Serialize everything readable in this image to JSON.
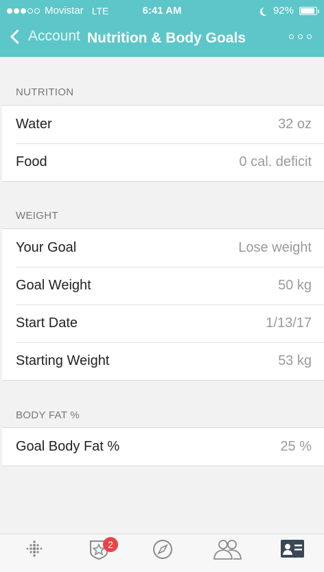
{
  "status": {
    "carrier": "Movistar",
    "network": "LTE",
    "time": "6:41 AM",
    "battery_text": "92%",
    "battery_level": 0.92,
    "signal_bars": 3
  },
  "nav": {
    "back_label": "Account",
    "title": "Nutrition & Body Goals"
  },
  "sections": {
    "nutrition": {
      "header": "NUTRITION",
      "rows": [
        {
          "label": "Water",
          "value": "32 oz"
        },
        {
          "label": "Food",
          "value": "0 cal. deficit"
        }
      ]
    },
    "weight": {
      "header": "WEIGHT",
      "rows": [
        {
          "label": "Your Goal",
          "value": "Lose weight"
        },
        {
          "label": "Goal Weight",
          "value": "50 kg"
        },
        {
          "label": "Start Date",
          "value": "1/13/17"
        },
        {
          "label": "Starting Weight",
          "value": "53 kg"
        }
      ]
    },
    "body_fat": {
      "header": "BODY FAT %",
      "rows": [
        {
          "label": "Goal Body Fat %",
          "value": "25 %"
        }
      ]
    }
  },
  "tabbar": {
    "challenges_badge": "2"
  },
  "colors": {
    "accent": "#5cc6c8",
    "badge": "#e84545",
    "active_tab": "#3a4856"
  }
}
